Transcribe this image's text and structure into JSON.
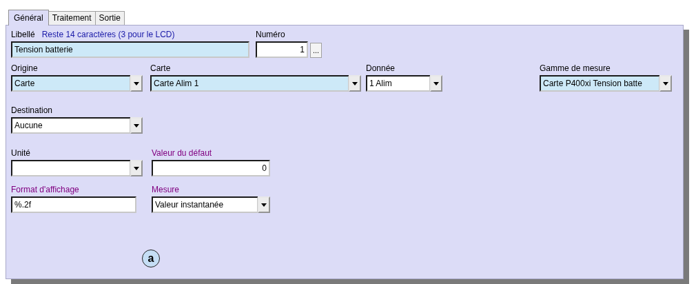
{
  "tabs": [
    {
      "label": "Général",
      "selected": true
    },
    {
      "label": "Traitement",
      "selected": false
    },
    {
      "label": "Sortie",
      "selected": false
    }
  ],
  "rows": [
    [
      {
        "label": "Libellé",
        "note": "Reste 14 caractères (3 pour le LCD)",
        "kind": "text",
        "value": "Tension batterie",
        "highlighted": true
      },
      {
        "label": "Numéro",
        "kind": "number",
        "value": "1",
        "highlighted": false,
        "button": "..."
      }
    ],
    [
      {
        "label": "Origine",
        "kind": "combo",
        "value": "Carte",
        "highlighted": true
      },
      {
        "label": "Carte",
        "kind": "combo",
        "value": "Carte Alim 1",
        "highlighted": true
      },
      {
        "label": "Donnée",
        "kind": "combo",
        "value": "1 Alim",
        "highlighted": false
      },
      {
        "label": "Gamme de mesure",
        "kind": "combo",
        "value": "Carte P400xi Tension batte",
        "highlighted": true
      }
    ],
    [
      {
        "label": "Destination",
        "kind": "combo",
        "value": "Aucune",
        "highlighted": false
      }
    ],
    [
      {
        "label": "Unité",
        "kind": "combo",
        "highlighted": false
      },
      {
        "label": "Valeur du défaut",
        "color": "#800080",
        "kind": "number",
        "value": "0",
        "highlighted": false
      }
    ],
    [
      {
        "label": "Format d'affichage",
        "color": "#800080",
        "kind": "text",
        "value": "%.2f",
        "highlighted": false
      },
      {
        "label": "Mesure",
        "color": "#800080",
        "kind": "combo",
        "value": "Valeur instantanée",
        "highlighted": false
      }
    ]
  ],
  "callout": "a"
}
